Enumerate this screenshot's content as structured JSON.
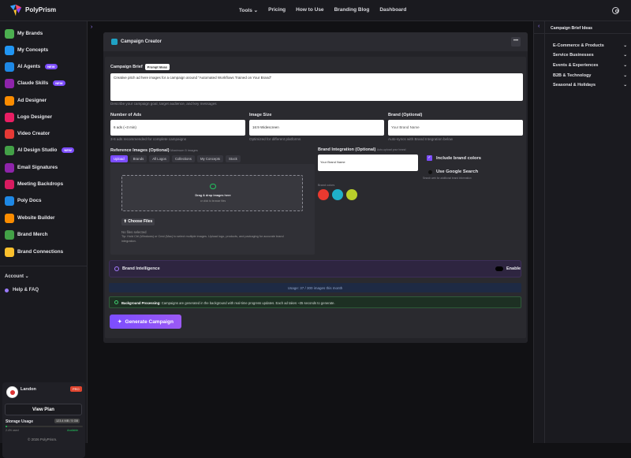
{
  "app": {
    "name": "PolyPrism",
    "nav": [
      "Tools ⌄",
      "Pricing",
      "How to Use",
      "Branding Blog",
      "Dashboard"
    ]
  },
  "sidebar": {
    "items": [
      {
        "label": "My Brands",
        "icon": "brands-icon",
        "color": "#4caf50",
        "new": false
      },
      {
        "label": "My Concepts",
        "icon": "concepts-icon",
        "color": "#2196f3",
        "new": false
      },
      {
        "label": "AI Agents",
        "icon": "agent-icon",
        "color": "#1e88e5",
        "new": true
      },
      {
        "label": "Claude Skills",
        "icon": "skills-icon",
        "color": "#8e24aa",
        "new": true
      },
      {
        "label": "Ad Designer",
        "icon": "ad-icon",
        "color": "#fb8c00",
        "new": false
      },
      {
        "label": "Logo Designer",
        "icon": "logo-designer-icon",
        "color": "#e91e63",
        "new": false
      },
      {
        "label": "Video Creator",
        "icon": "video-icon",
        "color": "#e53935",
        "new": false
      },
      {
        "label": "AI Design Studio",
        "icon": "studio-icon",
        "color": "#43a047",
        "new": true
      },
      {
        "label": "Email Signatures",
        "icon": "email-icon",
        "color": "#8e24aa",
        "new": false
      },
      {
        "label": "Meeting Backdrops",
        "icon": "meeting-icon",
        "color": "#d81b60",
        "new": false
      },
      {
        "label": "Poly Docs",
        "icon": "docs-icon",
        "color": "#1e88e5",
        "new": false
      },
      {
        "label": "Website Builder",
        "icon": "website-icon",
        "color": "#fb8c00",
        "new": false
      },
      {
        "label": "Brand Merch",
        "icon": "merch-icon",
        "color": "#43a047",
        "new": false
      },
      {
        "label": "Brand Connections",
        "icon": "connections-icon",
        "color": "#fbc02d",
        "new": false
      }
    ],
    "new_badge": "NEW",
    "account": "Account ⌄",
    "help": "Help & FAQ",
    "user": {
      "name": "Landon",
      "plan_badge": "PRO",
      "view_plan": "View Plan",
      "storage_label": "Storage Usage",
      "storage_value": "123.4 MB / 5 GB",
      "storage_used": "2.4% used",
      "storage_available": "Available",
      "storage_fraction": 0.024
    },
    "copyright": "© 2026 PolyPrism."
  },
  "right_panel": {
    "title": "Campaign Brief Ideas",
    "items": [
      "E-Commerce & Products",
      "Service Businesses",
      "Events & Experiences",
      "B2B & Technology",
      "Seasonal & Holidays"
    ]
  },
  "main": {
    "title": "Campaign Creator",
    "more": "•••",
    "brief_label": "Campaign Brief",
    "prompt_ideas": "Prompt Ideas",
    "brief_value": "Creative pitch ad here images for a campaign around \"Automated Workflows Trained on Your Brand\"",
    "brief_hint": "Describe your campaign goal, target audience, and key messages",
    "num_ads_label": "Number of Ads",
    "num_ads_value": "6 ads (~3 min)",
    "num_ads_hint": "3-6 ads recommended for complete campaigns",
    "image_size_label": "Image Size",
    "image_size_value": "16:9 Widescreen",
    "image_size_hint": "Optimized for different platforms",
    "brand_label": "Brand (Optional)",
    "brand_placeholder": "Your Brand Name",
    "brand_hint": "Auto-syncs with Brand Integration below",
    "ref_label": "Reference Images (Optional)",
    "ref_hint": "Maximum 5 images",
    "tabs": [
      "Upload",
      "Brands",
      "All Logos",
      "Collections",
      "My Concepts",
      "Stock"
    ],
    "drop_title": "Drag & drop images here",
    "drop_sub": "or click to browse files",
    "choose_files": "⬆ Choose Files",
    "no_file": "No files selected",
    "tip": "Tip: Hold Ctrl (Windows) or Cmd (Mac) to select multiple images. Upload logo, products, and packaging for accurate brand integration.",
    "integration_label": "Brand Integration (Optional)",
    "integration_hint": "Auto-upload your brand",
    "integration_placeholder": "Your Brand Name",
    "include_colors": "Include brand colors",
    "google_search": "Use Google Search",
    "google_hint": "Search web for additional brand information",
    "brand_colors_label": "Brand colors",
    "swatches": [
      "#e8392f",
      "#1fb0c9",
      "#b9cf2a"
    ],
    "intel_title": "Brand Intelligence",
    "enable": "Enable",
    "usage": "Usage: 37 / 300 images this month",
    "bg_title": "Background Processing:",
    "bg_text": " Campaigns are generated in the background with real-time progress updates. Each ad takes ~35 seconds to generate.",
    "generate": "Generate Campaign"
  }
}
